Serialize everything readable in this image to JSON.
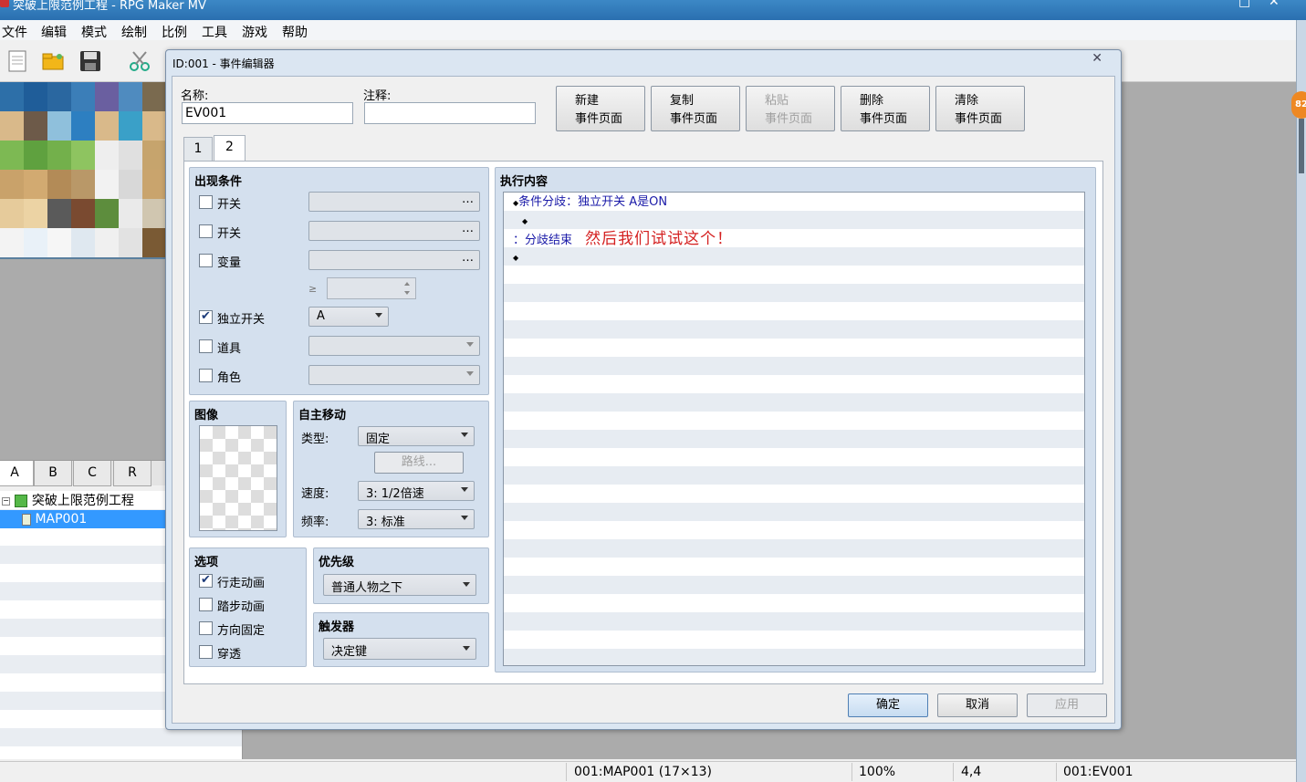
{
  "window": {
    "title": "突破上限范例工程 - RPG Maker MV",
    "minimize": "ˇ",
    "maximize": "□",
    "close": "✕",
    "notification_badge": "82"
  },
  "menu": [
    "文件",
    "编辑",
    "模式",
    "绘制",
    "比例",
    "工具",
    "游戏",
    "帮助"
  ],
  "tileset_tabs": [
    "A",
    "B",
    "C",
    "R"
  ],
  "tree": {
    "project": "突破上限范例工程",
    "map": "MAP001"
  },
  "status": {
    "map": "001:MAP001 (17×13)",
    "zoom": "100%",
    "coords": "4,4",
    "event": "001:EV001"
  },
  "dialog": {
    "title": "ID:001 - 事件编辑器",
    "close": "✕",
    "name_label": "名称:",
    "name_value": "EV001",
    "note_label": "注释:",
    "note_value": "",
    "page_buttons": [
      {
        "line1": "新建",
        "line2": "事件页面",
        "enabled": true
      },
      {
        "line1": "复制",
        "line2": "事件页面",
        "enabled": true
      },
      {
        "line1": "粘贴",
        "line2": "事件页面",
        "enabled": false
      },
      {
        "line1": "删除",
        "line2": "事件页面",
        "enabled": true
      },
      {
        "line1": "清除",
        "line2": "事件页面",
        "enabled": true
      }
    ],
    "tabs": [
      "1",
      "2"
    ],
    "active_tab": "2",
    "conditions": {
      "title": "出现条件",
      "switch1": {
        "label": "开关",
        "checked": false,
        "value": "",
        "button": "…"
      },
      "switch2": {
        "label": "开关",
        "checked": false,
        "value": "",
        "button": "…"
      },
      "variable": {
        "label": "变量",
        "checked": false,
        "value": "",
        "button": "…",
        "compare": "≥"
      },
      "self_switch": {
        "label": "独立开关",
        "checked": true,
        "value": "A"
      },
      "item": {
        "label": "道具",
        "checked": false,
        "value": ""
      },
      "actor": {
        "label": "角色",
        "checked": false,
        "value": ""
      }
    },
    "image": {
      "title": "图像"
    },
    "autonomous": {
      "title": "自主移动",
      "type_label": "类型:",
      "type_value": "固定",
      "route_button": "路线...",
      "speed_label": "速度:",
      "speed_value": "3: 1/2倍速",
      "freq_label": "频率:",
      "freq_value": "3: 标准"
    },
    "options": {
      "title": "选项",
      "items": [
        {
          "label": "行走动画",
          "checked": true
        },
        {
          "label": "踏步动画",
          "checked": false
        },
        {
          "label": "方向固定",
          "checked": false
        },
        {
          "label": "穿透",
          "checked": false
        }
      ]
    },
    "priority": {
      "title": "优先级",
      "value": "普通人物之下"
    },
    "trigger": {
      "title": "触发器",
      "value": "决定键"
    },
    "contents": {
      "title": "执行内容",
      "lines": [
        {
          "prefix": "◆",
          "text": "条件分歧：独立开关 A是ON"
        },
        {
          "prefix": "◆",
          "text": ""
        },
        {
          "prefix": "：",
          "text": "分歧结束"
        },
        {
          "prefix": "◆",
          "text": ""
        }
      ],
      "annotation": "然后我们试试这个！"
    },
    "footer": {
      "ok": "确定",
      "cancel": "取消",
      "apply": "应用"
    }
  }
}
